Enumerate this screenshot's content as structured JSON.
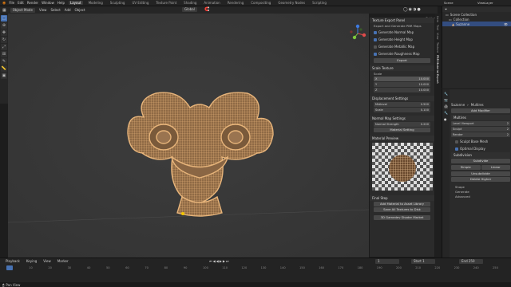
{
  "topbar": {
    "menus": [
      "File",
      "Edit",
      "Render",
      "Window",
      "Help"
    ],
    "tabs": [
      "Layout",
      "Modeling",
      "Sculpting",
      "UV Editing",
      "Texture Paint",
      "Shading",
      "Animation",
      "Rendering",
      "Compositing",
      "Geometry Nodes",
      "Scripting"
    ],
    "active_tab": "Layout",
    "scene_label": "Scene",
    "view_layer_label": "ViewLayer"
  },
  "vp_header": {
    "mode": "Object Mode",
    "menus": [
      "View",
      "Select",
      "Add",
      "Object"
    ],
    "transform": "Global",
    "options": "Options"
  },
  "npanel": {
    "title": "Texture Export Panel",
    "subtitle": "Export and Generate PBR Maps",
    "checks": [
      {
        "label": "Generate Normal Map",
        "checked": true
      },
      {
        "label": "Generate Height Map",
        "checked": true
      },
      {
        "label": "Generate Metallic Map",
        "checked": false
      },
      {
        "label": "Generate Roughness Map",
        "checked": true
      }
    ],
    "export_btn": "Export",
    "scale_btn": "Scale Texture",
    "scale_label": "Scale",
    "scale": [
      {
        "axis": "X",
        "value": "10.000"
      },
      {
        "axis": "Y",
        "value": "10.000"
      },
      {
        "axis": "Z",
        "value": "10.000"
      }
    ],
    "disp_title": "Displacement Settings",
    "disp": [
      {
        "label": "Midlevel",
        "value": "0.500"
      },
      {
        "label": "Scale",
        "value": "0.100"
      }
    ],
    "normal_title": "Normal Map Settings",
    "normal": {
      "label": "Normal Strength",
      "value": "0.200"
    },
    "material_btn": "Material Setting",
    "preview_title": "Material Preview",
    "final_title": "Final Step",
    "final_btns": [
      "Add Material to Asset Library",
      "Save All Textures to Disk"
    ],
    "footer_btn": "3D Gamedev Shader Market"
  },
  "sidetabs": [
    "Item",
    "Tool",
    "View",
    "Texture",
    "PBR Material Export"
  ],
  "outliner": {
    "title": "Scene Collection",
    "items": [
      {
        "label": "Collection",
        "indent": 1
      },
      {
        "label": "Suzanne",
        "indent": 2
      }
    ]
  },
  "props": {
    "breadcrumb": [
      "Suzanne",
      "Multires"
    ],
    "add_modifier": "Add Modifier",
    "modifier_name": "Multires",
    "levels": [
      {
        "label": "Level Viewport",
        "value": "2"
      },
      {
        "label": "Sculpt",
        "value": "2"
      },
      {
        "label": "Render",
        "value": "2"
      }
    ],
    "sculpt_base": "Sculpt Base Mesh",
    "optimal_display": "Optimal Display",
    "subdiv_title": "Subdivision",
    "subdiv_btns": [
      [
        "Subdivide"
      ],
      [
        "Simple",
        "Linear"
      ],
      [
        "Unsubdivide"
      ],
      [
        "Delete Higher"
      ]
    ],
    "sections": [
      "Shape",
      "Generate",
      "Advanced"
    ]
  },
  "timeline": {
    "menus": [
      "Playback",
      "Keying",
      "View",
      "Marker"
    ],
    "current_frame": "1",
    "start_label": "Start",
    "start": "1",
    "end_label": "End",
    "end": "250",
    "frames": [
      "1",
      "10",
      "20",
      "30",
      "40",
      "50",
      "60",
      "70",
      "80",
      "90",
      "100",
      "110",
      "120",
      "130",
      "140",
      "150",
      "160",
      "170",
      "180",
      "190",
      "200",
      "210",
      "220",
      "230",
      "240",
      "250"
    ],
    "status": "Pan View"
  },
  "colors": {
    "accent": "#4772b3",
    "mesh": "#e7b47a",
    "cursor": "#f2c500"
  }
}
